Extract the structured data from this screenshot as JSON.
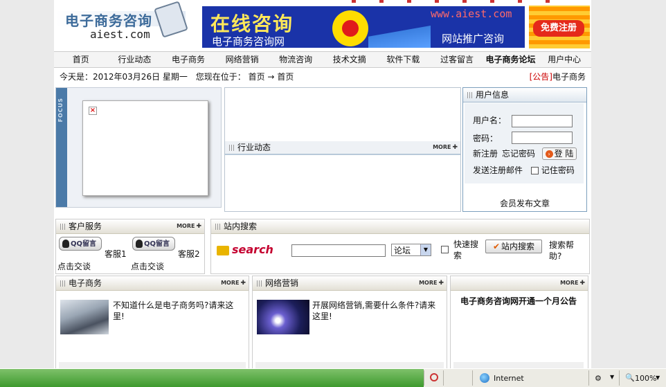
{
  "header": {
    "logo_cn": "电子商务咨询",
    "logo_en": "aiest.com",
    "banner_title": "在线咨询",
    "banner_site": "电子商务咨询网",
    "banner_url": "www.aiest.com",
    "banner_sub": "网站推广咨询",
    "register_label": "免费注册"
  },
  "nav": [
    "首页",
    "行业动态",
    "电子商务",
    "网络营销",
    "物流咨询",
    "技术文摘",
    "软件下载",
    "过客留言",
    "电子商务论坛",
    "用户中心"
  ],
  "info": {
    "date_text": "今天是：2012年03月26日 星期一",
    "location_label": "您现在位于：",
    "crumb_home": "首页",
    "crumb_arrow": "→",
    "crumb_current": "首页",
    "notice_tag": "[公告]",
    "notice_text": "电子商务"
  },
  "focus": {
    "side_label": "FOCUS"
  },
  "news": {
    "title": "行业动态",
    "more": "MORE"
  },
  "user": {
    "title": "用户信息",
    "username_label": "用户名：",
    "password_label": "密码：",
    "register_link": "新注册",
    "forgot_link": "忘记密码",
    "login_button": "登 陆",
    "send_mail_link": "发送注册邮件",
    "remember_label": "记住密码",
    "publish_link": "会员发布文章"
  },
  "service": {
    "title": "客户服务",
    "more": "MORE",
    "qq_label": "QQ留言",
    "agent1": "客服1",
    "agent2": "客服2",
    "chat1": "点击交谈",
    "chat2": "点击交谈"
  },
  "search": {
    "title": "站内搜索",
    "logo_text": "search",
    "select_value": "论坛",
    "quick_label": "快速搜索",
    "button": "站内搜索",
    "help": "搜索帮助?"
  },
  "columns": [
    {
      "title": "电子商务",
      "more": "MORE",
      "article": "不知道什么是电子商务吗?请来这里!"
    },
    {
      "title": "网络营销",
      "more": "MORE",
      "article": "开展网络营销,需要什么条件?请来这里!"
    },
    {
      "title": "",
      "more": "MORE",
      "article": "电子商务咨询网开通一个月公告"
    }
  ],
  "statusbar": {
    "zone": "Internet",
    "zoom": "100%"
  },
  "colors": {
    "nav_bg": "#f4f4f4",
    "focus_bar": "#4b7aa8",
    "banner_bg": "#1a33a8",
    "status_green": "#3e9a2e"
  }
}
